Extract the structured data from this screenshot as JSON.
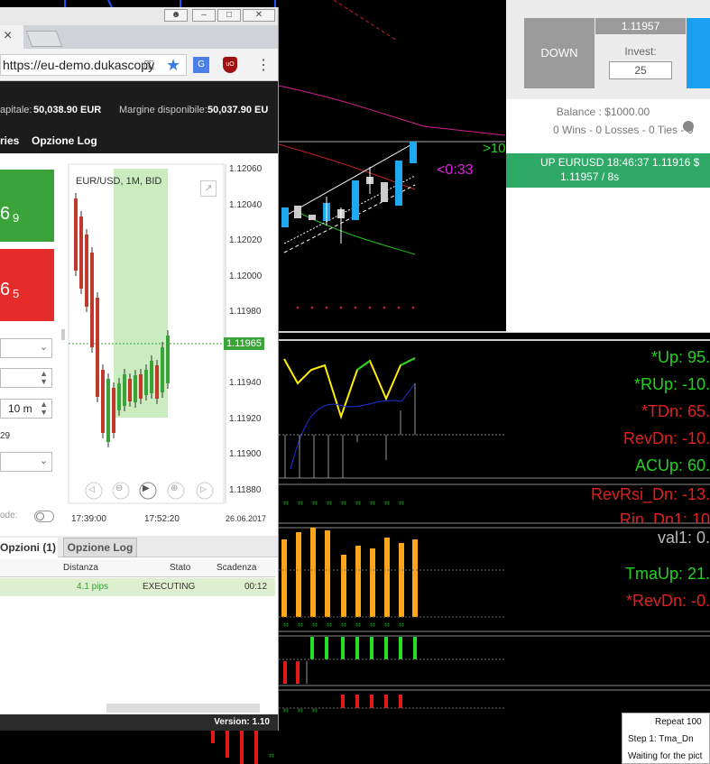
{
  "browser": {
    "title_buttons": [
      "–",
      "□",
      "✕"
    ],
    "tab_close": "×",
    "url": "https://eu-demo.dukascopy",
    "capitale_label": "apitale:",
    "capitale_value": "50,038.90 EUR",
    "margine_label": "Margine disponibile:",
    "margine_value": "50,037.90 EU",
    "nav_items": [
      "ries",
      "Opzione Log"
    ],
    "price_up_big": "6",
    "price_up_small": "9",
    "price_down_big": "6",
    "price_down_small": "5",
    "duration": "10 m",
    "mode_label": "ode:",
    "chart_title": "EUR/USD, 1M, BID",
    "current_price": "1.11965",
    "tabs": [
      "Opzioni (1)",
      "Opzione Log"
    ],
    "table_headers": [
      "Distanza",
      "Stato",
      "Scadenza"
    ],
    "row": {
      "distanza": "4.1 pips",
      "stato": "EXECUTING",
      "scadenza": "00:12"
    },
    "version": "Version: 1.10",
    "side_number": "29"
  },
  "chart_data": {
    "type": "candlestick",
    "title": "EUR/USD, 1M, BID",
    "y_ticks": [
      "1.12060",
      "1.12040",
      "1.12020",
      "1.12000",
      "1.11980",
      "1.11960",
      "1.11940",
      "1.11920",
      "1.11900",
      "1.11880"
    ],
    "x_ticks": [
      "17:39:00",
      "17:52:20",
      "26.06.2017"
    ],
    "current_price": 1.11965
  },
  "panel": {
    "down_label": "DOWN",
    "price": "1.11957",
    "invest_label": "Invest:",
    "invest_value": "25",
    "balance": "Balance : $1000.00",
    "stats": "0 Wins - 0 Losses - 0 Ties - 0",
    "signal_line1": "UP EURUSD 18:46:37 1.11916 $",
    "signal_line2": "1.11957 / 8s"
  },
  "mt4": {
    "arrow_label": ">10",
    "timer": "<0:33"
  },
  "indicators": [
    {
      "label": "*Up:",
      "value": "95.",
      "color": "#22d022"
    },
    {
      "label": "*RUp:",
      "value": "-10.",
      "color": "#22d022"
    },
    {
      "label": "*TDn:",
      "value": "65.",
      "color": "#e02020"
    },
    {
      "label": "RevDn:",
      "value": "-10.",
      "color": "#e02020"
    },
    {
      "label": "ACUp:",
      "value": "60.",
      "color": "#22d022"
    },
    {
      "label": "RevRsi_Dn:",
      "value": "-13.",
      "color": "#e02020"
    },
    {
      "label": "Rin_Dn1:",
      "value": "10",
      "color": "#e02020"
    },
    {
      "label": "val1:",
      "value": "0.",
      "color": "#bbbbbb"
    },
    {
      "label": "TmaUp:",
      "value": "21.",
      "color": "#22d022"
    },
    {
      "label": "*RevDn:",
      "value": "-0.",
      "color": "#e02020"
    }
  ],
  "repeat_box": {
    "title": "Repeat 100",
    "step": "Step 1: Tma_Dn",
    "status": "Waiting for the pict"
  }
}
